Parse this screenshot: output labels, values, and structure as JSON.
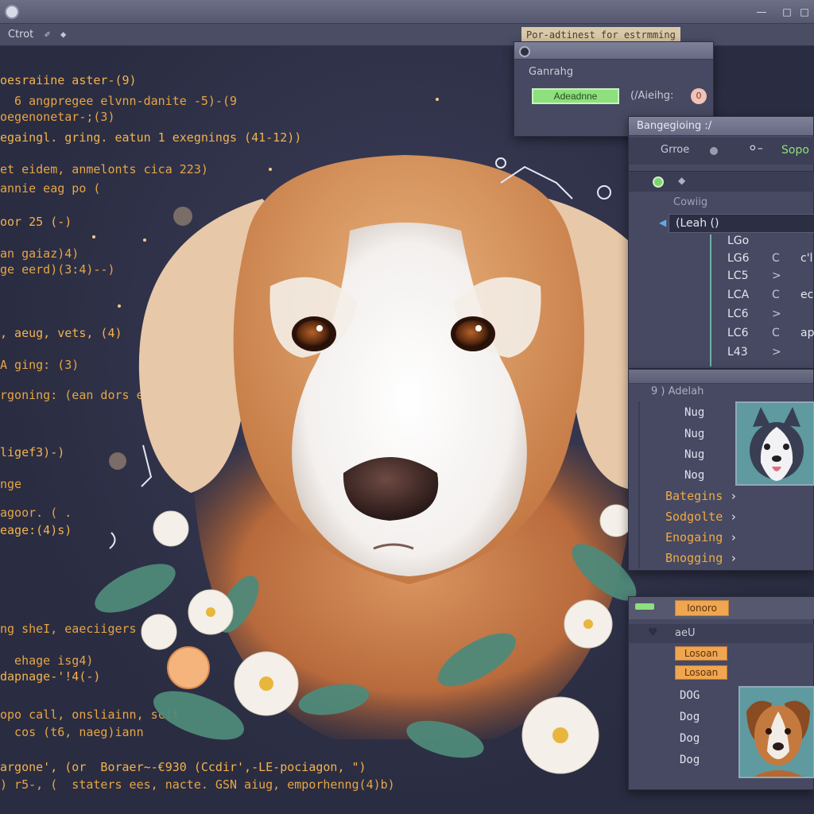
{
  "window": {
    "title_tab": "Ctrot",
    "tooltip": "Por-adtinest for estrmming"
  },
  "code_lines": [
    "oesraiine aster-(9)",
    "  6 angpregee elvnn-danite -5)-(9",
    "oegenonetar-;(3)",
    "egaingl. gring. eatun 1 exegnings (41-12))",
    "et eidem, anmelonts cica 223)",
    "annie eag po (",
    "oor 25 (-)",
    "an gaiaz)4)",
    "ge eerd)(3:4)--)",
    ", aeug, vets, (4)",
    "A ging: (3)",
    "rgoning: (ean dors e",
    "ligef3)-)",
    "nge",
    "agoor. ( .",
    "eage:(4)s)",
    "ng sheI, eaeciigers",
    "  ehage isg4)",
    "dapnage-'!4(-)",
    "opo call, onsliainn, scit",
    "  cos (t6, naeg)iann",
    "argone', (or  Boraer~-€930 (Ccdir',-LE-pociagon, \")",
    ") r5-, (  staters ees, nacte. GSN aiug, emporhenng(4)b)"
  ],
  "settings_panel": {
    "title": "Ganrahg",
    "active_button": "Adeadnne",
    "option_label": "(/Aieihg:",
    "toggle_value": "0"
  },
  "layers_panel": {
    "title": "Bangegioing :/",
    "toolbar_label": "Grroe",
    "toolbar_value": "Sopo",
    "section_label": "Cowiig",
    "selected_item": "(Leah ()",
    "rows": [
      {
        "code": "LGo",
        "mark": "",
        "value": ""
      },
      {
        "code": "LG6",
        "mark": "C",
        "value": "c'l"
      },
      {
        "code": "LC5",
        "mark": ">",
        "value": ""
      },
      {
        "code": "LCA",
        "mark": "C",
        "value": "ec"
      },
      {
        "code": "LC6",
        "mark": ">",
        "value": ""
      },
      {
        "code": "LC6",
        "mark": "C",
        "value": "ap"
      },
      {
        "code": "L43",
        "mark": ">",
        "value": ""
      }
    ]
  },
  "assets_panel": {
    "title": "9 ) Adelah",
    "items": [
      "Nug",
      "Nug",
      "Nug",
      "Nog"
    ],
    "menu": [
      "Bategins",
      "Sodgolte",
      "Enogaing",
      "Bnogging"
    ]
  },
  "results_panel": {
    "tag_label": "Ionoro",
    "section_title": "aeU",
    "chips": [
      "Losoan",
      "Losoan"
    ],
    "items": [
      "DOG",
      "Dog",
      "Dog",
      "Dog"
    ]
  },
  "colors": {
    "code": "#e6a645",
    "accent_green": "#8de07c",
    "accent_orange": "#f0a550",
    "panel": "#464961",
    "editor_bg": "#2c2f45"
  }
}
